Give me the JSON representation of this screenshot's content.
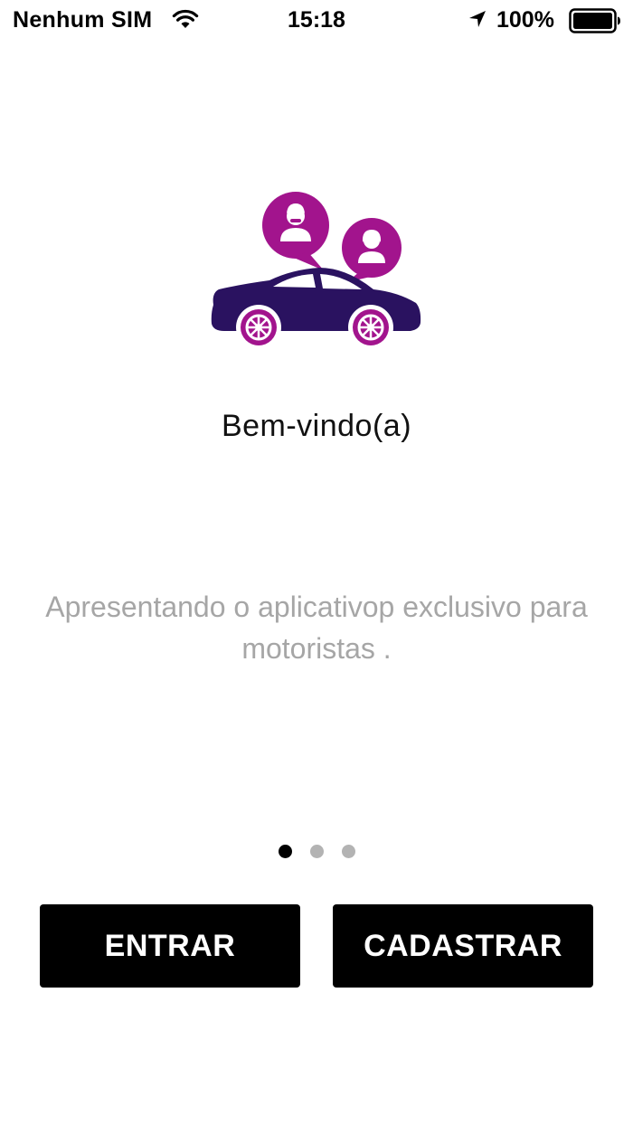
{
  "status_bar": {
    "carrier": "Nenhum SIM",
    "time": "15:18",
    "battery": "100%",
    "icons": [
      "wifi-icon",
      "location-arrow-icon",
      "battery-icon"
    ]
  },
  "hero": {
    "icon": "car-with-driver-and-passenger-illustration",
    "colors": {
      "car": "#2a1260",
      "accent": "#a2148d"
    }
  },
  "welcome": {
    "title": "Bem-vindo(a)",
    "subtitle": "Apresentando o aplicativop exclusivo para motoristas ."
  },
  "pager": {
    "page_count": 3,
    "current_page": 1
  },
  "actions": {
    "login_label": "ENTRAR",
    "register_label": "CADASTRAR"
  }
}
